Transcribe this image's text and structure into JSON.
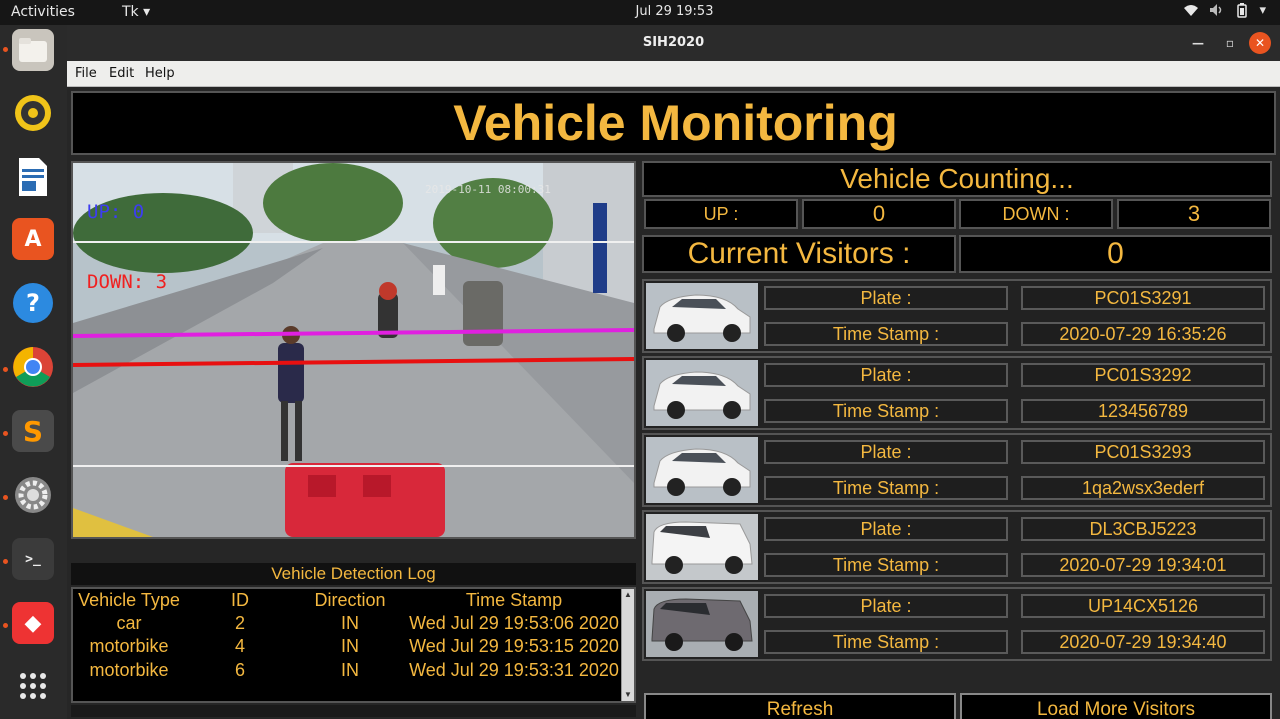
{
  "system": {
    "activities": "Activities",
    "app_menu": "Tk ▾",
    "clock": "Jul 29  19:53"
  },
  "window": {
    "title": "SIH2020",
    "menu": [
      "File",
      "Edit",
      "Help"
    ]
  },
  "header": {
    "title": "Vehicle Monitoring"
  },
  "video": {
    "overlay_up": "UP: 0",
    "overlay_down": "DOWN: 3",
    "timestamp": "2019-10-11 08:00:31"
  },
  "log": {
    "title": "Vehicle Detection Log",
    "columns": [
      "Vehicle Type",
      "ID",
      "Direction",
      "Time Stamp"
    ],
    "rows": [
      {
        "type": "car",
        "id": "2",
        "direction": "IN",
        "time": "Wed Jul 29 19:53:06 2020"
      },
      {
        "type": "motorbike",
        "id": "4",
        "direction": "IN",
        "time": "Wed Jul 29 19:53:15 2020"
      },
      {
        "type": "motorbike",
        "id": "6",
        "direction": "IN",
        "time": "Wed Jul 29 19:53:31 2020"
      }
    ]
  },
  "counting": {
    "title": "Vehicle Counting...",
    "up_label": "UP   :",
    "up_value": "0",
    "down_label": "DOWN :",
    "down_value": "3",
    "visitors_label": "Current Visitors :",
    "visitors_value": "0"
  },
  "visitors": [
    {
      "plate_label": "Plate :",
      "plate": "PC01S3291",
      "time_label": "Time Stamp :",
      "time": "2020-07-29 16:35:26",
      "car_color": "#f2f2f2"
    },
    {
      "plate_label": "Plate :",
      "plate": "PC01S3292",
      "time_label": "Time Stamp :",
      "time": "123456789",
      "car_color": "#f2f2f2"
    },
    {
      "plate_label": "Plate :",
      "plate": "PC01S3293",
      "time_label": "Time Stamp :",
      "time": "1qa2wsx3ederf",
      "car_color": "#f2f2f2"
    },
    {
      "plate_label": "Plate :",
      "plate": "DL3CBJ5223",
      "time_label": "Time Stamp :",
      "time": "2020-07-29 19:34:01",
      "car_color": "#f4f4f4"
    },
    {
      "plate_label": "Plate :",
      "plate": "UP14CX5126",
      "time_label": "Time Stamp :",
      "time": "2020-07-29 19:34:40",
      "car_color": "#6e6a70"
    }
  ],
  "buttons": {
    "refresh": "Refresh",
    "load_more": "Load More Visitors"
  },
  "colors": {
    "accent": "#f4b840",
    "up_overlay": "#3d3df0",
    "down_overlay": "#f02020",
    "line_magenta": "#e020e0",
    "line_red": "#e81010"
  }
}
